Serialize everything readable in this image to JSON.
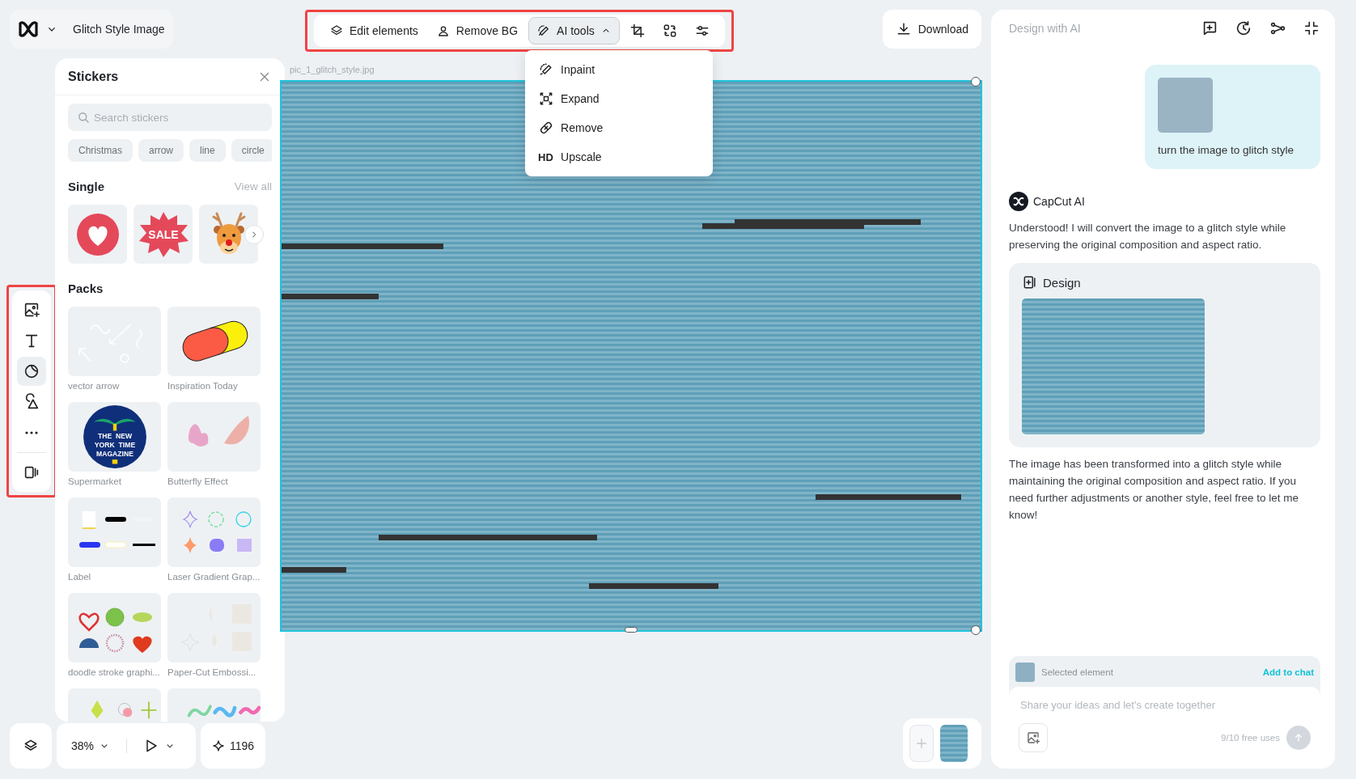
{
  "header": {
    "title": "Glitch Style Image"
  },
  "toolbar": {
    "buttons": [
      {
        "label": "Edit elements",
        "kind": "layers",
        "selected": false,
        "expanded": false
      },
      {
        "label": "Remove BG",
        "kind": "person",
        "selected": false,
        "expanded": false
      },
      {
        "label": "AI tools",
        "kind": "ai",
        "selected": true,
        "expanded": true
      }
    ],
    "menu": [
      {
        "label": "Inpaint",
        "kind": "inpaint"
      },
      {
        "label": "Expand",
        "kind": "expand"
      },
      {
        "label": "Remove",
        "kind": "remove"
      },
      {
        "label": "Upscale",
        "kind": "hd",
        "icon_text": "HD"
      }
    ]
  },
  "download": {
    "label": "Download"
  },
  "rail": {
    "items": [
      {
        "kind": "add-image",
        "selected": false
      },
      {
        "kind": "text",
        "selected": false
      },
      {
        "kind": "sticker",
        "selected": true
      },
      {
        "kind": "shapes",
        "selected": false
      },
      {
        "kind": "more",
        "selected": false
      },
      {
        "kind": "panel",
        "selected": false
      }
    ]
  },
  "stickers_panel": {
    "title": "Stickers",
    "search": {
      "placeholder": "Search stickers"
    },
    "chips": [
      "Christmas",
      "arrow",
      "line",
      "circle"
    ],
    "single": {
      "heading": "Single",
      "link": "View all",
      "items": [
        {
          "kind": "heart"
        },
        {
          "kind": "sale",
          "text": "SALE"
        },
        {
          "kind": "reindeer"
        }
      ]
    },
    "packs": {
      "heading": "Packs",
      "items": [
        {
          "name": "vector arrow",
          "kind": "arrows"
        },
        {
          "name": "Inspiration Today",
          "kind": "capsule"
        },
        {
          "name": "Supermarket",
          "kind": "badge",
          "text_lines": [
            "THE  NEW",
            "YORK  TIME",
            "MAGAZINE"
          ]
        },
        {
          "name": "Butterfly Effect",
          "kind": "butterflies"
        },
        {
          "name": "Label",
          "kind": "labels"
        },
        {
          "name": "Laser Gradient Grap...",
          "kind": "gradient"
        },
        {
          "name": "doodle stroke graphi...",
          "kind": "doodle"
        },
        {
          "name": "Paper-Cut Embossi...",
          "kind": "papercut"
        },
        {
          "kind": "drops"
        },
        {
          "kind": "waves"
        }
      ]
    }
  },
  "canvas": {
    "file_name": "pic_1_glitch_style.jpg",
    "selected": true
  },
  "bottom_bar": {
    "zoom": "38%",
    "credits": "1196"
  },
  "chat": {
    "title": "Design with AI",
    "user_message": {
      "text": "turn the image to glitch style"
    },
    "ai_reply": {
      "author": "CapCut AI",
      "text": "Understood! I will convert the image to a glitch style while preserving the original composition and aspect ratio.",
      "design_title": "Design",
      "followup": "The image has been transformed into a glitch style while maintaining the original composition and aspect ratio. If you need further adjustments or another style, feel free to let me know!"
    },
    "composer": {
      "selected_label": "Selected element",
      "add_link": "Add to chat",
      "placeholder": "Share your ideas and let's create together",
      "uses": "9/10 free uses"
    }
  }
}
